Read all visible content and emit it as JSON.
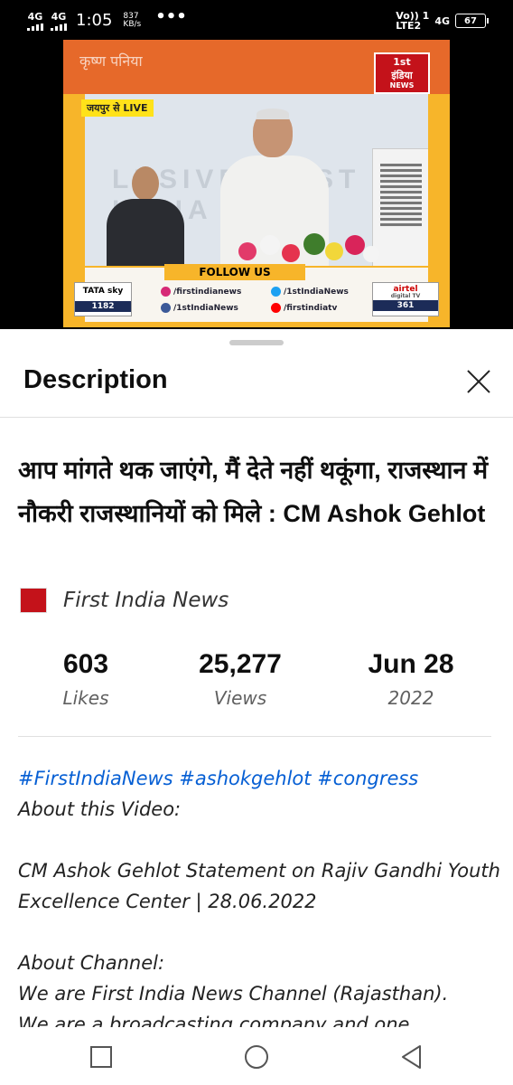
{
  "status_bar": {
    "sim1": "4G",
    "sim2": "4G",
    "time": "1:05",
    "speed_value": "837",
    "speed_unit": "KB/s",
    "more": "•••",
    "volte": "Vo)) 1",
    "lte": "LTE2",
    "net": "4G",
    "battery": "67"
  },
  "video": {
    "frame_text": "कृष्ण पनिया",
    "live_tag": "जयपुर से LIVE",
    "logo_line1": "1st",
    "logo_line2": "इंडिया",
    "logo_line3": "NEWS",
    "wall_text": "LUSIVE  FIRST INDIA",
    "follow_us": "FOLLOW US",
    "tata_sky": "TATA sky",
    "tata_num": "1182",
    "social": [
      "/firstindianews",
      "/1stIndiaNews",
      "/1stIndiaNews",
      "/firstindiatv"
    ],
    "airtel": "airtel",
    "airtel_sub": "digital TV",
    "airtel_num": "361",
    "progress_fraction": 0.02
  },
  "sheet": {
    "title": "Description",
    "video_title": "आप मांगते थक जाएंगे, मैं देते नहीं थकूंगा, राजस्थान में नौकरी राजस्थानियों को मिले : CM Ashok Gehlot",
    "channel_name": "First India News",
    "stats": [
      {
        "value": "603",
        "label": "Likes"
      },
      {
        "value": "25,277",
        "label": "Views"
      },
      {
        "value": "Jun 28",
        "label": "2022"
      }
    ],
    "hashtags": [
      "#FirstIndiaNews",
      "#ashokgehlot",
      "#congress"
    ],
    "about_video_label": "About this Video:",
    "statement": "CM Ashok Gehlot Statement on Rajiv Gandhi Youth Excellence Center | 28.06.2022",
    "about_channel_label": "About Channel:",
    "channel_line1": "We are First India News Channel (Rajasthan).",
    "channel_line2": "We are a broadcasting company and one"
  }
}
